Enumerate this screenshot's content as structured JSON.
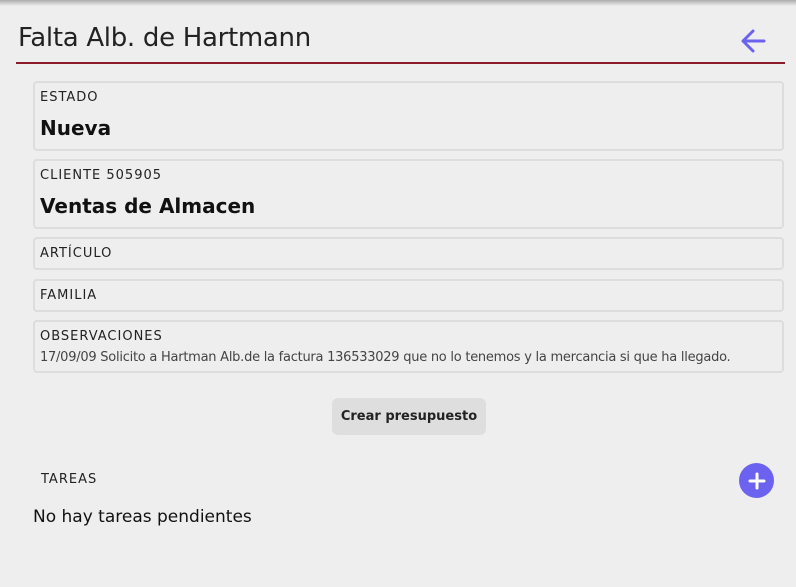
{
  "header": {
    "title": "Falta Alb. de Hartmann",
    "back_icon": "arrow-left-icon",
    "accent_color": "#6b63f0",
    "underline_color": "#8b1a2b"
  },
  "fields": {
    "estado": {
      "label": "ESTADO",
      "value": "Nueva"
    },
    "cliente": {
      "label": "CLIENTE 505905",
      "value": "Ventas de Almacen"
    },
    "articulo": {
      "label": "ARTÍCULO"
    },
    "familia": {
      "label": "FAMILIA"
    },
    "observaciones": {
      "label": "OBSERVACIONES",
      "text": "17/09/09 Solicito a Hartman Alb.de la factura 136533029 que no lo tenemos y la mercancia si que ha llegado."
    }
  },
  "actions": {
    "create_budget_label": "Crear presupuesto"
  },
  "tasks": {
    "label": "TAREAS",
    "add_icon": "plus-icon",
    "empty_message": "No hay tareas pendientes"
  }
}
